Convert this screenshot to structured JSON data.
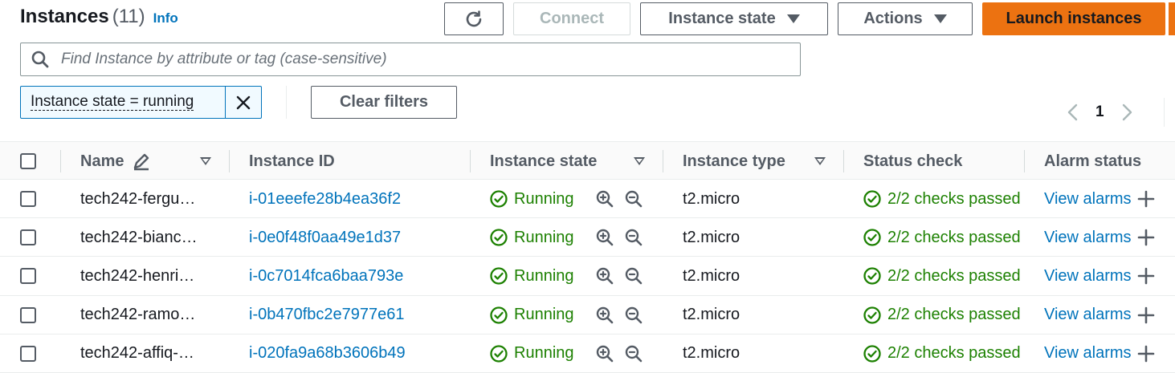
{
  "header": {
    "title": "Instances",
    "count": "(11)",
    "info": "Info"
  },
  "toolbar": {
    "refresh_icon": "refresh-icon",
    "connect": "Connect",
    "instance_state": "Instance state",
    "actions": "Actions",
    "launch": "Launch instances",
    "launch_color": "#ec7211"
  },
  "search": {
    "placeholder": "Find Instance by attribute or tag (case-sensitive)",
    "value": ""
  },
  "filters": {
    "token": "Instance state = running",
    "clear": "Clear filters"
  },
  "pagination": {
    "page": "1"
  },
  "columns": {
    "name": "Name",
    "instance_id": "Instance ID",
    "instance_state": "Instance state",
    "instance_type": "Instance type",
    "status_check": "Status check",
    "alarm_status": "Alarm status"
  },
  "rows": [
    {
      "name": "tech242-fergu…",
      "id": "i-01eeefe28b4ea36f2",
      "state": "Running",
      "type": "t2.micro",
      "status": "2/2 checks passed",
      "alarm": "View alarms"
    },
    {
      "name": "tech242-bianc…",
      "id": "i-0e0f48f0aa49e1d37",
      "state": "Running",
      "type": "t2.micro",
      "status": "2/2 checks passed",
      "alarm": "View alarms"
    },
    {
      "name": "tech242-henri…",
      "id": "i-0c7014fca6baa793e",
      "state": "Running",
      "type": "t2.micro",
      "status": "2/2 checks passed",
      "alarm": "View alarms"
    },
    {
      "name": "tech242-ramo…",
      "id": "i-0b470fbc2e7977e61",
      "state": "Running",
      "type": "t2.micro",
      "status": "2/2 checks passed",
      "alarm": "View alarms"
    },
    {
      "name": "tech242-affiq-…",
      "id": "i-020fa9a68b3606b49",
      "state": "Running",
      "type": "t2.micro",
      "status": "2/2 checks passed",
      "alarm": "View alarms"
    }
  ],
  "colors": {
    "link": "#0073bb",
    "success": "#1d8102",
    "primary": "#ec7211"
  }
}
